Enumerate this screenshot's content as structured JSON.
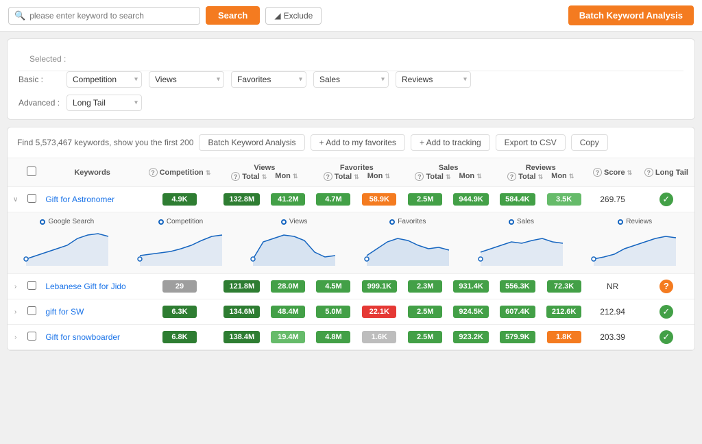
{
  "topBar": {
    "searchPlaceholder": "please enter keyword to search",
    "searchButtonLabel": "Search",
    "excludeButtonLabel": "Exclude",
    "batchButtonLabel": "Batch Keyword Analysis"
  },
  "filters": {
    "basicLabel": "Basic :",
    "advancedLabel": "Advanced :",
    "basicOptions": [
      "Competition",
      "Views",
      "Favorites",
      "Sales",
      "Reviews"
    ],
    "advancedOptions": [
      "Long Tail"
    ]
  },
  "toolbar": {
    "findText": "Find 5,573,467 keywords,  show you the first 200",
    "batchLabel": "Batch Keyword Analysis",
    "favoritesLabel": "+ Add to my favorites",
    "trackingLabel": "+ Add to tracking",
    "exportLabel": "Export to CSV",
    "copyLabel": "Copy"
  },
  "table": {
    "columns": {
      "keywords": "Keywords",
      "competition": "Competition",
      "views": "Views",
      "viewsTotal": "Total",
      "viewsMon": "Mon",
      "favorites": "Favorites",
      "favoritesTotal": "Total",
      "favoritesMon": "Mon",
      "sales": "Sales",
      "salesTotal": "Total",
      "salesMon": "Mon",
      "reviews": "Reviews",
      "reviewsTotal": "Total",
      "reviewsMon": "Mon",
      "score": "Score",
      "longTail": "Long Tail"
    },
    "rows": [
      {
        "id": 1,
        "keyword": "Gift for Astronomer",
        "competition": "4.9K",
        "competitionClass": "badge-green-dark",
        "viewsTotal": "132.8M",
        "viewsTotalClass": "badge-green-dark",
        "viewsMon": "41.2M",
        "viewsMonClass": "badge-green",
        "favTotal": "4.7M",
        "favTotalClass": "badge-green",
        "favMon": "58.9K",
        "favMonClass": "badge-orange",
        "salesTotal": "2.5M",
        "salesTotalClass": "badge-green",
        "salesMon": "944.9K",
        "salesMonClass": "badge-green",
        "reviewsTotal": "584.4K",
        "reviewsTotalClass": "badge-green",
        "reviewsMon": "3.5K",
        "reviewsMonClass": "badge-green-med",
        "score": "269.75",
        "longTail": "check",
        "expanded": true
      },
      {
        "id": 2,
        "keyword": "Lebanese Gift for Jido",
        "competition": "29",
        "competitionClass": "badge-gray",
        "viewsTotal": "121.8M",
        "viewsTotalClass": "badge-green-dark",
        "viewsMon": "28.0M",
        "viewsMonClass": "badge-green",
        "favTotal": "4.5M",
        "favTotalClass": "badge-green",
        "favMon": "999.1K",
        "favMonClass": "badge-green",
        "salesTotal": "2.3M",
        "salesTotalClass": "badge-green",
        "salesMon": "931.4K",
        "salesMonClass": "badge-green",
        "reviewsTotal": "556.3K",
        "reviewsTotalClass": "badge-green",
        "reviewsMon": "72.3K",
        "reviewsMonClass": "badge-green",
        "score": "NR",
        "longTail": "question",
        "expanded": false
      },
      {
        "id": 3,
        "keyword": "gift for SW",
        "competition": "6.3K",
        "competitionClass": "badge-green-dark",
        "viewsTotal": "134.6M",
        "viewsTotalClass": "badge-green-dark",
        "viewsMon": "48.4M",
        "viewsMonClass": "badge-green",
        "favTotal": "5.0M",
        "favTotalClass": "badge-green",
        "favMon": "22.1K",
        "favMonClass": "badge-red",
        "salesTotal": "2.5M",
        "salesTotalClass": "badge-green",
        "salesMon": "924.5K",
        "salesMonClass": "badge-green",
        "reviewsTotal": "607.4K",
        "reviewsTotalClass": "badge-green",
        "reviewsMon": "212.6K",
        "reviewsMonClass": "badge-green",
        "score": "212.94",
        "longTail": "check",
        "expanded": false
      },
      {
        "id": 4,
        "keyword": "Gift for snowboarder",
        "competition": "6.8K",
        "competitionClass": "badge-green-dark",
        "viewsTotal": "138.4M",
        "viewsTotalClass": "badge-green-dark",
        "viewsMon": "19.4M",
        "viewsMonClass": "badge-green-med",
        "favTotal": "4.8M",
        "favTotalClass": "badge-green",
        "favMon": "1.6K",
        "favMonClass": "badge-light-gray",
        "salesTotal": "2.5M",
        "salesTotalClass": "badge-green",
        "salesMon": "923.2K",
        "salesMonClass": "badge-green",
        "reviewsTotal": "579.9K",
        "reviewsTotalClass": "badge-green",
        "reviewsMon": "1.8K",
        "reviewsMonClass": "badge-orange",
        "score": "203.39",
        "longTail": "check",
        "expanded": false
      }
    ]
  }
}
